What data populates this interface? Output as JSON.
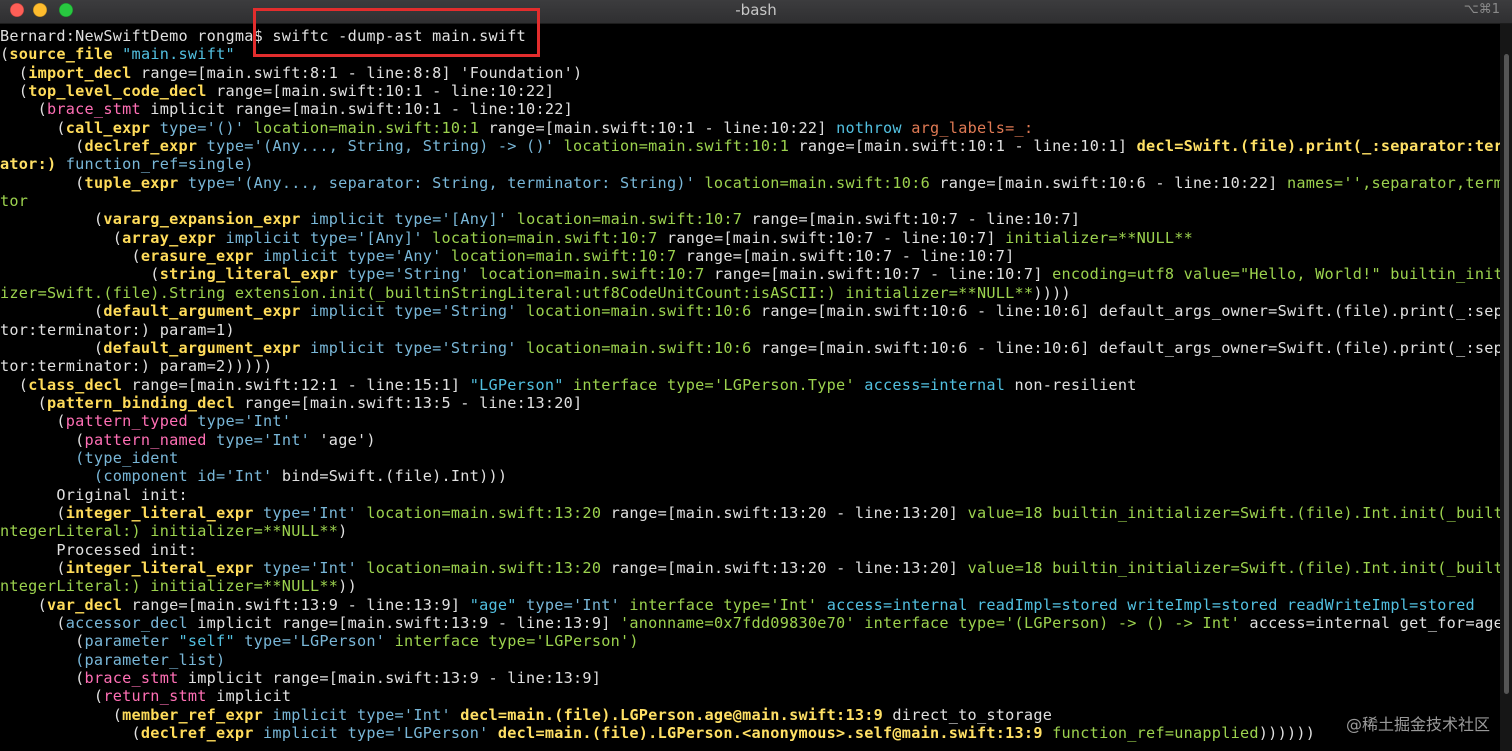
{
  "window": {
    "title": "-bash",
    "shortcut": "⌥⌘1"
  },
  "watermark": "@稀土掘金技术社区",
  "lines": [
    [
      [
        "w",
        "Bernard:NewSwiftDemo rongma$ swiftc -dump-ast main.swift"
      ]
    ],
    [
      [
        "w",
        "("
      ],
      [
        "k",
        "source_file"
      ],
      [
        "w",
        " "
      ],
      [
        "c",
        "\"main.swift\""
      ]
    ],
    [
      [
        "w",
        "  ("
      ],
      [
        "k",
        "import_decl"
      ],
      [
        "w",
        " range=[main.swift:8:1 - line:8:8] 'Foundation')"
      ]
    ],
    [
      [
        "w",
        "  ("
      ],
      [
        "k",
        "top_level_code_decl"
      ],
      [
        "w",
        " range=[main.swift:10:1 - line:10:22]"
      ]
    ],
    [
      [
        "w",
        "    ("
      ],
      [
        "kr",
        "brace_stmt"
      ],
      [
        "w",
        " implicit range=[main.swift:10:1 - line:10:22]"
      ]
    ],
    [
      [
        "w",
        "      ("
      ],
      [
        "k",
        "call_expr"
      ],
      [
        "p",
        " type='()'"
      ],
      [
        "g",
        " location=main.swift:10:1"
      ],
      [
        "w",
        " range=[main.swift:10:1 - line:10:22]"
      ],
      [
        "c",
        " nothrow"
      ],
      [
        "o",
        " arg_labels=_:"
      ]
    ],
    [
      [
        "w",
        "        ("
      ],
      [
        "k",
        "declref_expr"
      ],
      [
        "p",
        " type='(Any..., String, String) -> ()'"
      ],
      [
        "g",
        " location=main.swift:10:1"
      ],
      [
        "w",
        " range=[main.swift:10:1 - line:10:1]"
      ],
      [
        "y",
        " decl=Swift.(file).print(_:separator:termin"
      ]
    ],
    [
      [
        "y",
        "ator:)"
      ],
      [
        "p",
        " function_ref=single)"
      ]
    ],
    [
      [
        "w",
        "        ("
      ],
      [
        "k",
        "tuple_expr"
      ],
      [
        "p",
        " type='(Any..., separator: String, terminator: String)'"
      ],
      [
        "g",
        " location=main.swift:10:6"
      ],
      [
        "w",
        " range=[main.swift:10:6 - line:10:22]"
      ],
      [
        "g",
        " names='',separator,termina"
      ]
    ],
    [
      [
        "g",
        "tor"
      ]
    ],
    [
      [
        "w",
        "          ("
      ],
      [
        "k",
        "vararg_expansion_expr"
      ],
      [
        "p",
        " implicit type='[Any]'"
      ],
      [
        "g",
        " location=main.swift:10:7"
      ],
      [
        "w",
        " range=[main.swift:10:7 - line:10:7]"
      ]
    ],
    [
      [
        "w",
        "            ("
      ],
      [
        "k",
        "array_expr"
      ],
      [
        "p",
        " implicit type='[Any]'"
      ],
      [
        "g",
        " location=main.swift:10:7"
      ],
      [
        "w",
        " range=[main.swift:10:7 - line:10:7]"
      ],
      [
        "g",
        " initializer=**NULL**"
      ]
    ],
    [
      [
        "w",
        "              ("
      ],
      [
        "k",
        "erasure_expr"
      ],
      [
        "p",
        " implicit type='Any'"
      ],
      [
        "g",
        " location=main.swift:10:7"
      ],
      [
        "w",
        " range=[main.swift:10:7 - line:10:7]"
      ]
    ],
    [
      [
        "w",
        "                ("
      ],
      [
        "k",
        "string_literal_expr"
      ],
      [
        "p",
        " type='String'"
      ],
      [
        "g",
        " location=main.swift:10:7"
      ],
      [
        "w",
        " range=[main.swift:10:7 - line:10:7]"
      ],
      [
        "g",
        " encoding=utf8 value=\"Hello, World!\" builtin_initial"
      ]
    ],
    [
      [
        "g",
        "izer=Swift.(file).String extension.init(_builtinStringLiteral:utf8CodeUnitCount:isASCII:) initializer=**NULL**"
      ],
      [
        "w",
        "))))"
      ]
    ],
    [
      [
        "w",
        "          ("
      ],
      [
        "k",
        "default_argument_expr"
      ],
      [
        "p",
        " implicit type='String'"
      ],
      [
        "g",
        " location=main.swift:10:6"
      ],
      [
        "w",
        " range=[main.swift:10:6 - line:10:6] default_args_owner=Swift.(file).print(_:separa"
      ]
    ],
    [
      [
        "w",
        "tor:terminator:) param=1)"
      ]
    ],
    [
      [
        "w",
        "          ("
      ],
      [
        "k",
        "default_argument_expr"
      ],
      [
        "p",
        " implicit type='String'"
      ],
      [
        "g",
        " location=main.swift:10:6"
      ],
      [
        "w",
        " range=[main.swift:10:6 - line:10:6] default_args_owner=Swift.(file).print(_:separa"
      ]
    ],
    [
      [
        "w",
        "tor:terminator:) param=2)))))"
      ]
    ],
    [
      [
        "w",
        "  ("
      ],
      [
        "k",
        "class_decl"
      ],
      [
        "w",
        " range=[main.swift:12:1 - line:15:1]"
      ],
      [
        "c",
        " \"LGPerson\""
      ],
      [
        "g",
        " interface type='LGPerson.Type'"
      ],
      [
        "c",
        " access=internal"
      ],
      [
        "w",
        " non-resilient"
      ]
    ],
    [
      [
        "w",
        "    ("
      ],
      [
        "k",
        "pattern_binding_decl"
      ],
      [
        "w",
        " range=[main.swift:13:5 - line:13:20]"
      ]
    ],
    [
      [
        "w",
        "      ("
      ],
      [
        "kr",
        "pattern_typed"
      ],
      [
        "p",
        " type='Int'"
      ]
    ],
    [
      [
        "w",
        "        ("
      ],
      [
        "kr",
        "pattern_named"
      ],
      [
        "p",
        " type='Int'"
      ],
      [
        "w",
        " 'age')"
      ]
    ],
    [
      [
        "p",
        "        (type_ident"
      ]
    ],
    [
      [
        "p",
        "          (component id='Int'"
      ],
      [
        "w",
        " bind=Swift.(file).Int)))"
      ]
    ],
    [
      [
        "w",
        "      Original init:"
      ]
    ],
    [
      [
        "w",
        "      ("
      ],
      [
        "k",
        "integer_literal_expr"
      ],
      [
        "p",
        " type='Int'"
      ],
      [
        "g",
        " location=main.swift:13:20"
      ],
      [
        "w",
        " range=[main.swift:13:20 - line:13:20]"
      ],
      [
        "g",
        " value=18 builtin_initializer=Swift.(file).Int.init(_builtinI"
      ]
    ],
    [
      [
        "g",
        "ntegerLiteral:) initializer=**NULL**"
      ],
      [
        "w",
        ")"
      ]
    ],
    [
      [
        "w",
        "      Processed init:"
      ]
    ],
    [
      [
        "w",
        "      ("
      ],
      [
        "k",
        "integer_literal_expr"
      ],
      [
        "p",
        " type='Int'"
      ],
      [
        "g",
        " location=main.swift:13:20"
      ],
      [
        "w",
        " range=[main.swift:13:20 - line:13:20]"
      ],
      [
        "g",
        " value=18 builtin_initializer=Swift.(file).Int.init(_builtinI"
      ]
    ],
    [
      [
        "g",
        "ntegerLiteral:) initializer=**NULL**"
      ],
      [
        "w",
        "))"
      ]
    ],
    [
      [
        "w",
        "    ("
      ],
      [
        "k",
        "var_decl"
      ],
      [
        "w",
        " range=[main.swift:13:9 - line:13:9]"
      ],
      [
        "c",
        " \"age\""
      ],
      [
        "p",
        " type='Int'"
      ],
      [
        "g",
        " interface type='Int'"
      ],
      [
        "c",
        " access=internal"
      ],
      [
        "c",
        " readImpl=stored writeImpl=stored readWriteImpl=stored"
      ]
    ],
    [
      [
        "w",
        "      ("
      ],
      [
        "p",
        "accessor_decl"
      ],
      [
        "w",
        " implicit range=[main.swift:13:9 - line:13:9]"
      ],
      [
        "g",
        " 'anonname=0x7fdd09830e70'"
      ],
      [
        "g",
        " interface type='(LGPerson) -> () -> Int'"
      ],
      [
        "w",
        " access=internal get_for=age"
      ]
    ],
    [
      [
        "w",
        "        ("
      ],
      [
        "p",
        "parameter"
      ],
      [
        "c",
        " \"self\""
      ],
      [
        "p",
        " type='LGPerson'"
      ],
      [
        "g",
        " interface type='LGPerson')"
      ]
    ],
    [
      [
        "p",
        "        (parameter_list)"
      ]
    ],
    [
      [
        "w",
        "        ("
      ],
      [
        "kr",
        "brace_stmt"
      ],
      [
        "w",
        " implicit range=[main.swift:13:9 - line:13:9]"
      ]
    ],
    [
      [
        "w",
        "          ("
      ],
      [
        "kr",
        "return_stmt"
      ],
      [
        "w",
        " implicit"
      ]
    ],
    [
      [
        "w",
        "            ("
      ],
      [
        "k",
        "member_ref_expr"
      ],
      [
        "p",
        " implicit type='Int'"
      ],
      [
        "y",
        " decl=main.(file).LGPerson.age@main.swift:13:9"
      ],
      [
        "w",
        " direct_to_storage"
      ]
    ],
    [
      [
        "w",
        "              ("
      ],
      [
        "k",
        "declref_expr"
      ],
      [
        "p",
        " implicit type='LGPerson'"
      ],
      [
        "y",
        " decl=main.(file).LGPerson.<anonymous>.self@main.swift:13:9"
      ],
      [
        "g",
        " function_ref=unapplied"
      ],
      [
        "w",
        "))))))"
      ]
    ]
  ]
}
